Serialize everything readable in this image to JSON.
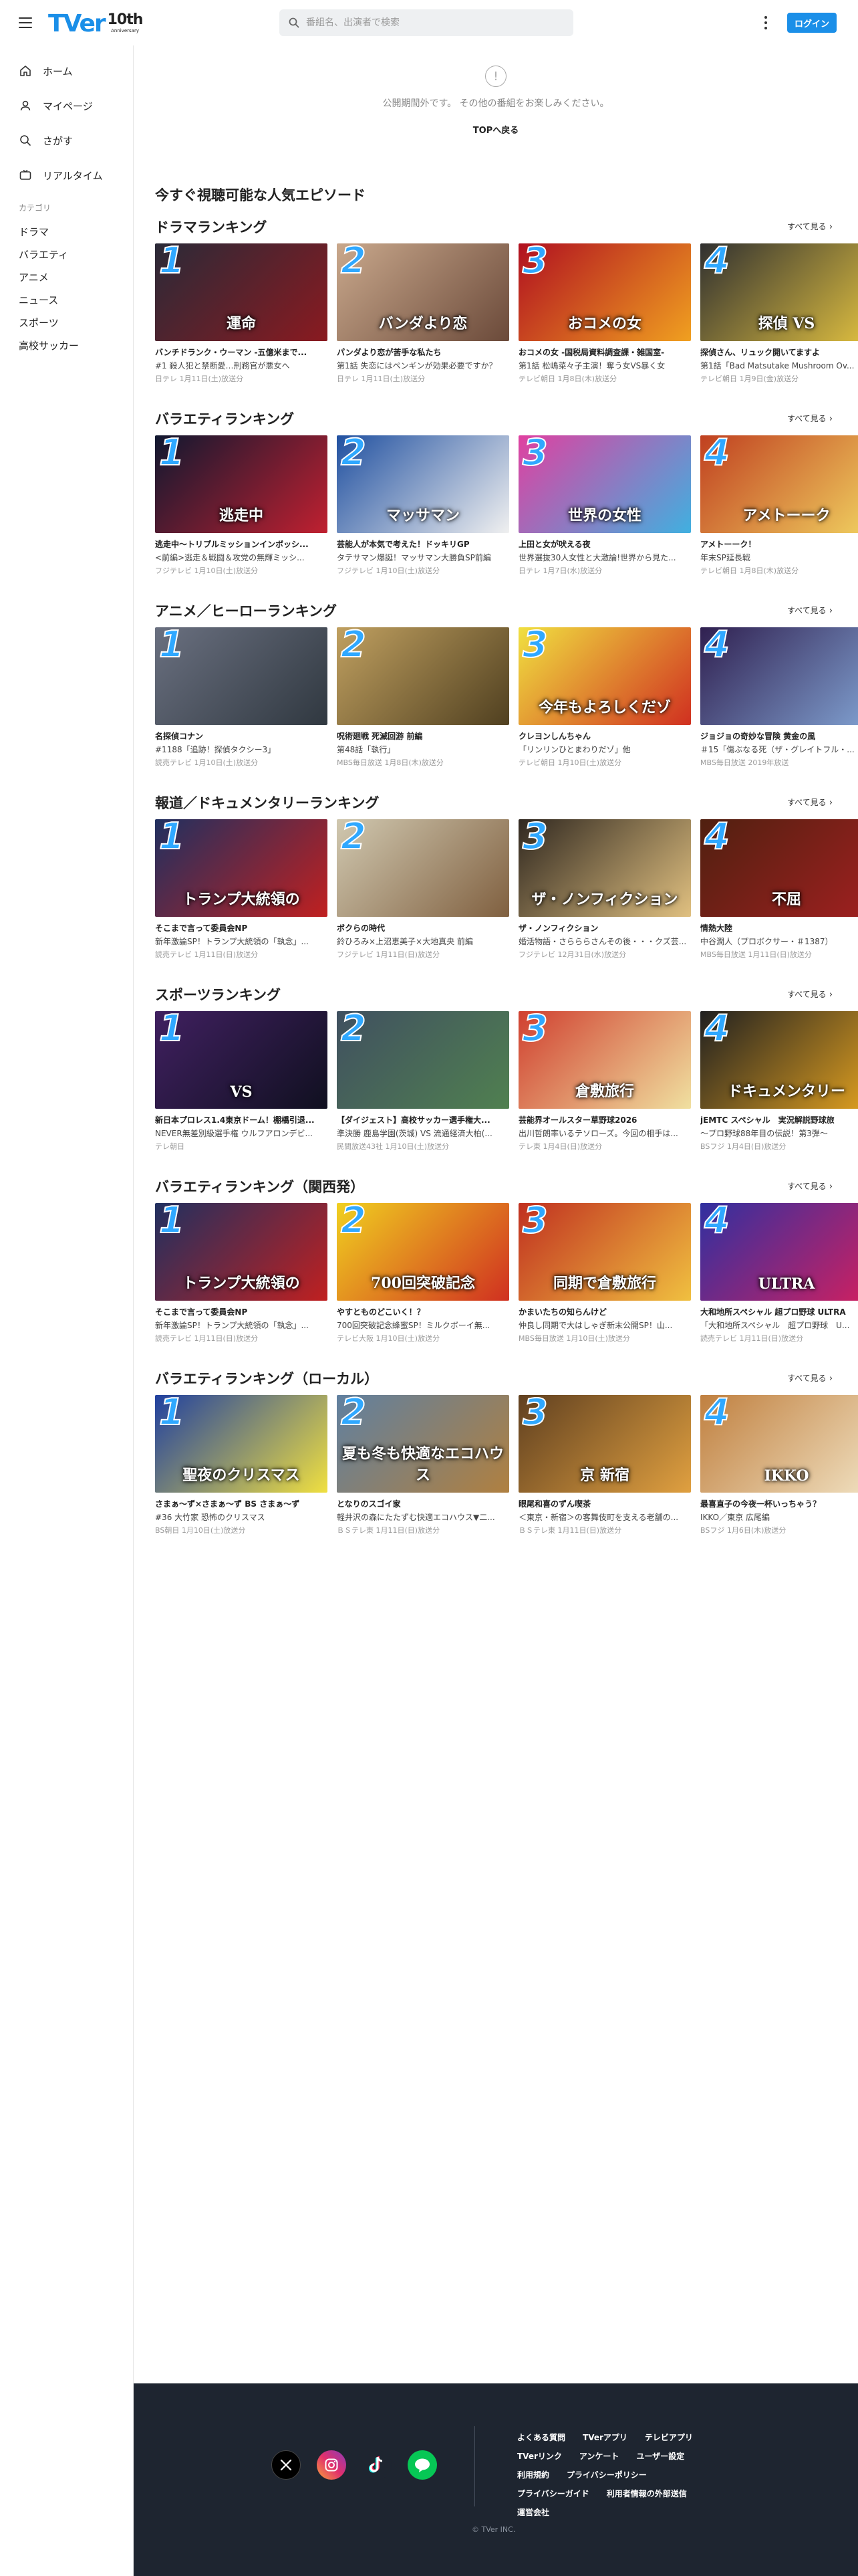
{
  "header": {
    "logo_text": "TVer",
    "anniversary_number": "10th",
    "anniversary_text": "Anniversary",
    "search_placeholder": "番組名、出演者で検索",
    "login_label": "ログイン"
  },
  "sidebar": {
    "items": [
      {
        "label": "ホーム",
        "icon": "home-icon"
      },
      {
        "label": "マイページ",
        "icon": "user-icon"
      },
      {
        "label": "さがす",
        "icon": "search-icon"
      },
      {
        "label": "リアルタイム",
        "icon": "tv-icon"
      }
    ],
    "category_label": "カテゴリ",
    "categories": [
      "ドラマ",
      "バラエティ",
      "アニメ",
      "ニュース",
      "スポーツ",
      "高校サッカー"
    ]
  },
  "notice": {
    "icon": "!",
    "message": "公開期間外です。 その他の番組をお楽しみください。",
    "top_link": "TOPへ戻る"
  },
  "page_title": "今すぐ視聴可能な人気エピソード",
  "see_all_label": "すべて見る",
  "sections": [
    {
      "title": "ドラマランキング",
      "cards": [
        {
          "rank": "1",
          "caption": "運命",
          "colors": [
            "#2a2a38",
            "#8a1a20"
          ],
          "title": "バンチドランク・ウーマン ‐五億米まで...",
          "sub": "#1 殺人犯と禁断愛…刑務官が悪女へ",
          "meta": "日テレ 1月11日(土)放送分"
        },
        {
          "rank": "2",
          "caption": "バンダより恋",
          "colors": [
            "#c9a88c",
            "#6b4a3a"
          ],
          "title": "パンダより恋が苦手な私たち",
          "sub": "第1話 失恋にはペンギンが効果必要ですか？",
          "meta": "日テレ 1月11日(土)放送分"
        },
        {
          "rank": "3",
          "caption": "おコメの女",
          "colors": [
            "#b01020",
            "#f0a020"
          ],
          "title": "おコメの女 ‐国税局資料調査課・雑国室‐",
          "sub": "第1話 松嶋菜々子主演！奪う女VS暴く女",
          "meta": "テレビ朝日 1月8日(木)放送分"
        },
        {
          "rank": "4",
          "caption": "探偵 VS",
          "colors": [
            "#303030",
            "#e0c040"
          ],
          "title": "探偵さん、リュック開いてますよ",
          "sub": "第1話「Bad Matsutake Mushroom Ov...",
          "meta": "テレビ朝日 1月9日(金)放送分"
        }
      ]
    },
    {
      "title": "バラエティランキング",
      "cards": [
        {
          "rank": "1",
          "caption": "逃走中",
          "colors": [
            "#101830",
            "#c02030"
          ],
          "title": "逃走中〜トリプルミッションインボッシ...",
          "sub": "<前編>逃走＆戦闘＆攻党の無輝ミッシ...",
          "meta": "フジテレビ 1月10日(土)放送分"
        },
        {
          "rank": "2",
          "caption": "マッサマン",
          "colors": [
            "#2050a0",
            "#f0f0f0"
          ],
          "title": "芸能人が本気で考えた！ドッキリGP",
          "sub": "タテサマン爆誕！マッサマン大勝負SP前編",
          "meta": "フジテレビ 1月10日(土)放送分"
        },
        {
          "rank": "3",
          "caption": "世界の女性",
          "colors": [
            "#e040a0",
            "#40b0e0"
          ],
          "title": "上田と女が吠える夜",
          "sub": "世界選抜30人女性と大激論!世界から見た...",
          "meta": "日テレ 1月7日(水)放送分"
        },
        {
          "rank": "4",
          "caption": "アメトーーク",
          "colors": [
            "#c04020",
            "#f0d060"
          ],
          "title": "アメトーーク！",
          "sub": "年末SP延長戦",
          "meta": "テレビ朝日 1月8日(木)放送分"
        }
      ]
    },
    {
      "title": "アニメ／ヒーローランキング",
      "cards": [
        {
          "rank": "1",
          "caption": "",
          "colors": [
            "#6a7080",
            "#303840"
          ],
          "title": "名探偵コナン",
          "sub": "#1188「追跡！探偵タクシー3」",
          "meta": "読売テレビ 1月10日(土)放送分"
        },
        {
          "rank": "2",
          "caption": "",
          "colors": [
            "#c0a060",
            "#504020"
          ],
          "title": "呪術廻戦 死滅回游 前編",
          "sub": "第48話「執行」",
          "meta": "MBS毎日放送 1月8日(木)放送分"
        },
        {
          "rank": "3",
          "caption": "今年もよろしくだゾ",
          "colors": [
            "#f0e040",
            "#d03020"
          ],
          "title": "クレヨンしんちゃん",
          "sub": "「リンリンひとまわりだゾ」他",
          "meta": "テレビ朝日 1月10日(土)放送分"
        },
        {
          "rank": "4",
          "caption": "",
          "colors": [
            "#302050",
            "#80a0d0"
          ],
          "title": "ジョジョの奇妙な冒険 黄金の風",
          "sub": "＃15「傷ぶなる死（ザ・グレイトフル・...",
          "meta": "MBS毎日放送 2019年放送"
        }
      ]
    },
    {
      "title": "報道／ドキュメンタリーランキング",
      "cards": [
        {
          "rank": "1",
          "caption": "トランプ大統領の",
          "colors": [
            "#203060",
            "#c02020"
          ],
          "title": "そこまで言って委員会NP",
          "sub": "新年激論SP！トランプ大統領の「執念」...",
          "meta": "読売テレビ 1月11日(日)放送分"
        },
        {
          "rank": "2",
          "caption": "",
          "colors": [
            "#d0c8b0",
            "#806040"
          ],
          "title": "ボクらの時代",
          "sub": "鈴ひろみ×上沼恵美子×大地真央 前編",
          "meta": "フジテレビ 1月11日(日)放送分"
        },
        {
          "rank": "3",
          "caption": "ザ・ノンフィクション",
          "colors": [
            "#302820",
            "#e0c080"
          ],
          "title": "ザ・ノンフィクション",
          "sub": "婚活物語・さらららさんその後・・・クズ芸...",
          "meta": "フジテレビ 12月31日(水)放送分"
        },
        {
          "rank": "4",
          "caption": "不屈",
          "colors": [
            "#502010",
            "#a02020"
          ],
          "title": "情熱大陸",
          "sub": "中谷潤人（プロボクサー・＃1387）",
          "meta": "MBS毎日放送 1月11日(日)放送分"
        }
      ]
    },
    {
      "title": "スポーツランキング",
      "cards": [
        {
          "rank": "1",
          "caption": "VS",
          "colors": [
            "#402060",
            "#101020"
          ],
          "title": "新日本プロレス1.4東京ドーム！棚橋引退...",
          "sub": "NEVER無差別級選手権 ウルフアロンデビ...",
          "meta": "テレ朝日"
        },
        {
          "rank": "2",
          "caption": "",
          "colors": [
            "#405060",
            "#508050"
          ],
          "title": "【ダイジェスト】高校サッカー選手権大...",
          "sub": "準決勝 鹿島学園(茨城) VS 流通経済大柏(...",
          "meta": "民間放送43社 1月10日(土)放送分"
        },
        {
          "rank": "3",
          "caption": "倉敷旅行",
          "colors": [
            "#d04030",
            "#f0e0a0"
          ],
          "title": "芸能界オールスター草野球2026",
          "sub": "出川哲朗率いるテソローズ。今回の相手は...",
          "meta": "テレ東 1月4日(日)放送分"
        },
        {
          "rank": "4",
          "caption": "ドキュメンタリー",
          "colors": [
            "#202020",
            "#e0a020"
          ],
          "title": "jEMTC スペシャル　実況解説野球旅",
          "sub": "〜プロ野球88年目の伝説！第3弾〜",
          "meta": "BSフジ 1月4日(日)放送分"
        }
      ]
    },
    {
      "title": "バラエティランキング（関西発）",
      "cards": [
        {
          "rank": "1",
          "caption": "トランプ大統領の",
          "colors": [
            "#203060",
            "#c02020"
          ],
          "title": "そこまで言って委員会NP",
          "sub": "新年激論SP！トランプ大統領の「執念」...",
          "meta": "読売テレビ 1月11日(日)放送分"
        },
        {
          "rank": "2",
          "caption": "700回突破記念",
          "colors": [
            "#f0d020",
            "#d03020"
          ],
          "title": "やすとものどこいく！？",
          "sub": "700回突破記念蜂蜜SP！ミルクボーイ無...",
          "meta": "テレビ大阪 1月10日(土)放送分"
        },
        {
          "rank": "3",
          "caption": "同期で倉敷旅行",
          "colors": [
            "#c03020",
            "#f0c040"
          ],
          "title": "かまいたちの知らんけど",
          "sub": "仲良し同期で大はしゃぎ新末公開SP！山...",
          "meta": "MBS毎日放送 1月10日(土)放送分"
        },
        {
          "rank": "4",
          "caption": "ULTRA",
          "colors": [
            "#3030a0",
            "#d02060"
          ],
          "title": "大和地所スペシャル 超プロ野球 ULTRA",
          "sub": "「大和地所スペシャル　超プロ野球　U...",
          "meta": "読売テレビ 1月11日(日)放送分"
        }
      ]
    },
    {
      "title": "バラエティランキング（ローカル）",
      "cards": [
        {
          "rank": "1",
          "caption": "聖夜のクリスマス",
          "colors": [
            "#2040a0",
            "#f0e040"
          ],
          "title": "さまぁ〜ず×さまぁ〜ず BS さまぁ〜ず",
          "sub": "#36 大竹家 恐怖のクリスマス",
          "meta": "BS朝日 1月10日(土)放送分"
        },
        {
          "rank": "2",
          "caption": "夏も冬も快適なエコハウス",
          "colors": [
            "#6080a0",
            "#b08040"
          ],
          "title": "となりのスゴイ家",
          "sub": "軽井沢の森にたたずむ快適エコハウス▼二...",
          "meta": "ＢＳテレ東 1月11日(日)放送分"
        },
        {
          "rank": "3",
          "caption": "京 新宿",
          "colors": [
            "#604020",
            "#e0a040"
          ],
          "title": "眼尾和喜のずん喫茶",
          "sub": "＜東京・新宿＞の客舞伎町を支える老舗の...",
          "meta": "ＢＳテレ東 1月11日(日)放送分"
        },
        {
          "rank": "4",
          "caption": "IKKO",
          "colors": [
            "#c08040",
            "#f0e0c0"
          ],
          "title": "最喜直子の今夜一杯いっちゃう？",
          "sub": "IKKO／東京 広尾編",
          "meta": "BSフジ 1月6日(木)放送分"
        }
      ]
    }
  ],
  "footer": {
    "socials": [
      "x-icon",
      "instagram-icon",
      "tiktok-icon",
      "line-icon"
    ],
    "link_rows": [
      [
        "よくある質問",
        "TVerアプリ",
        "テレビアプリ"
      ],
      [
        "TVerリンク",
        "アンケート",
        "ユーザー設定"
      ],
      [
        "利用規約",
        "プライバシーポリシー"
      ],
      [
        "プライバシーガイド",
        "利用者情報の外部送信"
      ],
      [
        "運営会社"
      ]
    ],
    "copyright": "© TVer INC."
  }
}
